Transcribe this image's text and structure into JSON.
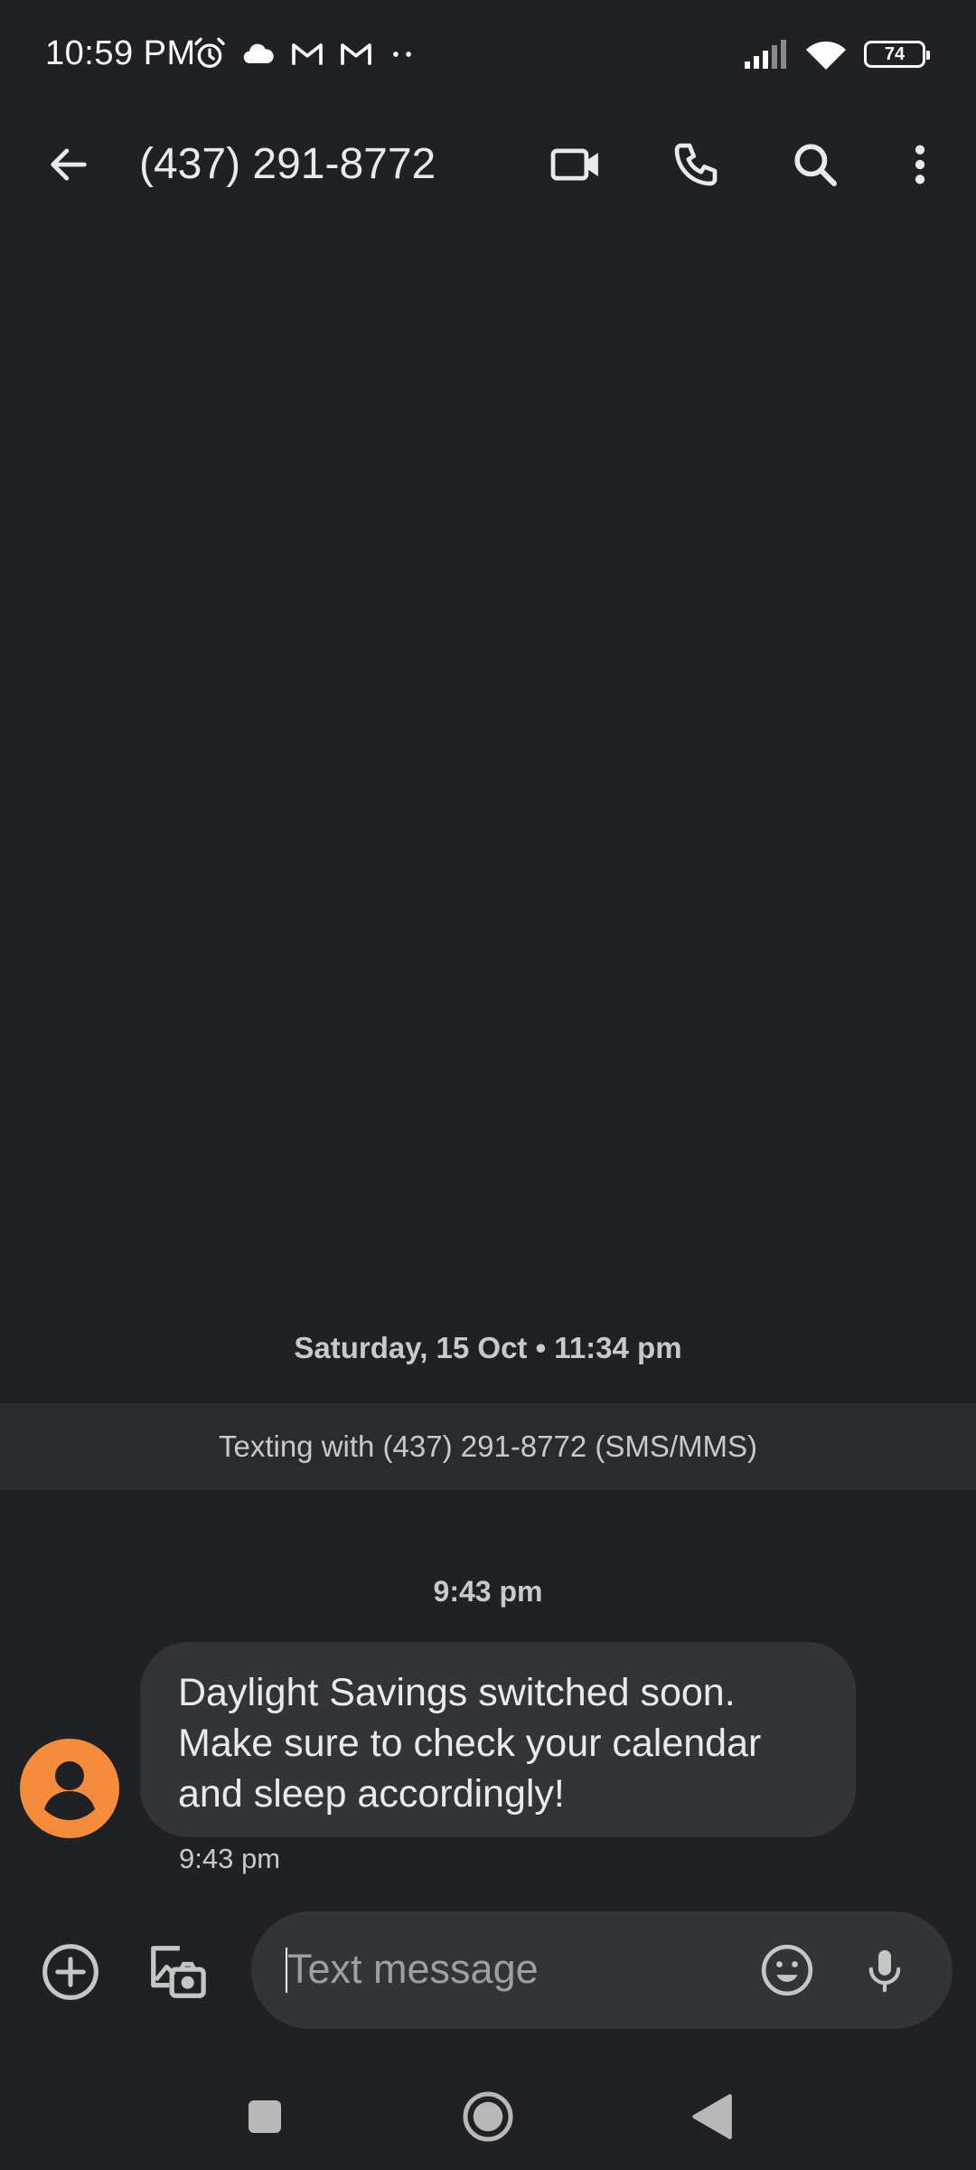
{
  "status_bar": {
    "time": "10:59 PM",
    "battery": "74",
    "left_icons": [
      "alarm-icon",
      "cloud-icon",
      "gmail-icon",
      "gmail-icon",
      "more-dots-icon"
    ],
    "right_icons": [
      "signal-icon",
      "wifi-icon",
      "battery-icon"
    ]
  },
  "app_bar": {
    "title": "(437) 291-8772",
    "actions": [
      "back-arrow-icon",
      "video-call-icon",
      "phone-icon",
      "search-icon",
      "more-vert-icon"
    ]
  },
  "conversation": {
    "date_header": "Saturday, 15 Oct • 11:34 pm",
    "banner": "Texting with (437) 291-8772 (SMS/MMS)",
    "time_divider": "9:43 pm",
    "messages": [
      {
        "lines": [
          "Daylight Savings switched soon.",
          "Make sure to check your calendar",
          "and sleep accordingly!"
        ],
        "time": "9:43 pm",
        "avatar_color": "#f58c3c"
      }
    ]
  },
  "compose": {
    "placeholder": "Text message",
    "value": ""
  },
  "colors": {
    "background": "#202124",
    "bubble": "#333437",
    "banner": "#2a2b2e",
    "avatar": "#f58c3c"
  },
  "nav_bar": {
    "buttons": [
      "recents-square-icon",
      "home-circle-icon",
      "back-triangle-icon"
    ]
  }
}
